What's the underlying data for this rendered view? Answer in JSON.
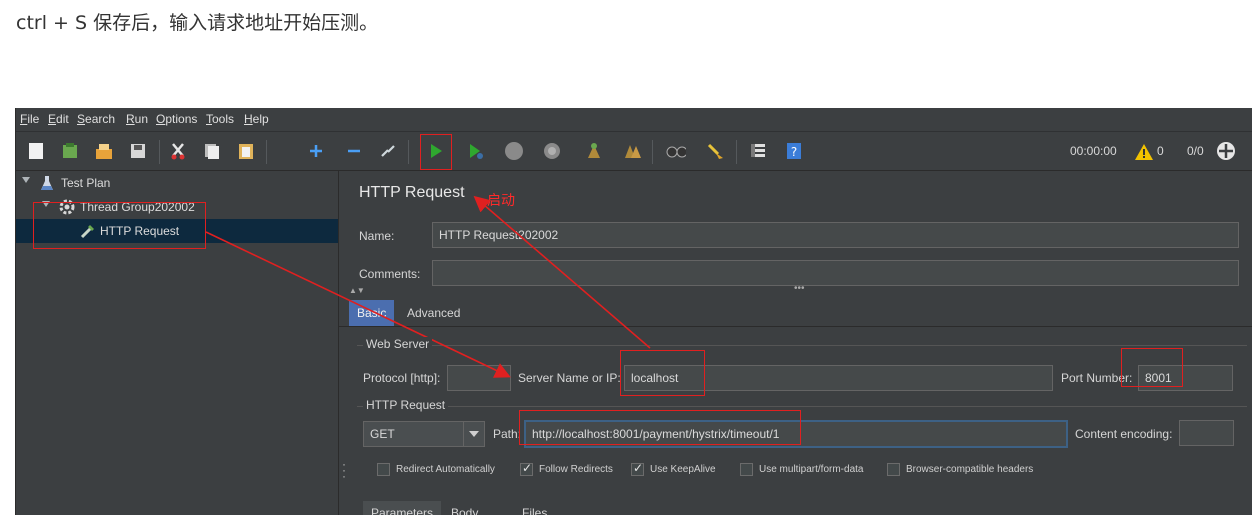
{
  "caption": "ctrl + S 保存后，输入请求地址开始压测。",
  "menu": [
    "File",
    "Edit",
    "Search",
    "Run",
    "Options",
    "Tools",
    "Help"
  ],
  "toolbar": {
    "icons": [
      "new-icon",
      "templates-icon",
      "open-icon",
      "save-icon",
      "cut-icon",
      "copy-icon",
      "paste-icon",
      "expand-icon",
      "collapse-icon",
      "toggle-icon",
      "start-icon",
      "start-no-pause-icon",
      "stop-icon",
      "shutdown-icon",
      "clear-icon",
      "clear-all-icon",
      "search-icon",
      "reset-search-icon",
      "function-helper-icon",
      "help-icon"
    ],
    "timer": "00:00:00",
    "warning_count": "0",
    "threads": "0/0"
  },
  "tree": {
    "test_plan": "Test Plan",
    "thread_group": "Thread Group202002",
    "http_request": "HTTP Request"
  },
  "panel": {
    "title": "HTTP Request",
    "name_label": "Name:",
    "name_value": "HTTP Request202002",
    "comments_label": "Comments:",
    "comments_value": "",
    "tabs": [
      "Basic",
      "Advanced"
    ],
    "web_server": "Web Server",
    "protocol_label": "Protocol [http]:",
    "protocol_value": "",
    "server_label": "Server Name or IP:",
    "server_value": "localhost",
    "port_label": "Port Number:",
    "port_value": "8001",
    "http_request_group": "HTTP Request",
    "method": "GET",
    "path_label": "Path:",
    "path_value": "http://localhost:8001/payment/hystrix/timeout/1",
    "encoding_label": "Content encoding:",
    "encoding_value": "",
    "checkboxes": [
      {
        "label": "Redirect Automatically",
        "checked": false
      },
      {
        "label": "Follow Redirects",
        "checked": true
      },
      {
        "label": "Use KeepAlive",
        "checked": true
      },
      {
        "label": "Use multipart/form-data",
        "checked": false
      },
      {
        "label": "Browser-compatible headers",
        "checked": false
      }
    ],
    "subtabs": [
      "Parameters",
      "Body Data",
      "Files Upload"
    ]
  },
  "annotation": "启动",
  "colors": {
    "annotation_red": "#e02020",
    "selection": "#0d293e",
    "tab_active": "#4b6eaf"
  }
}
